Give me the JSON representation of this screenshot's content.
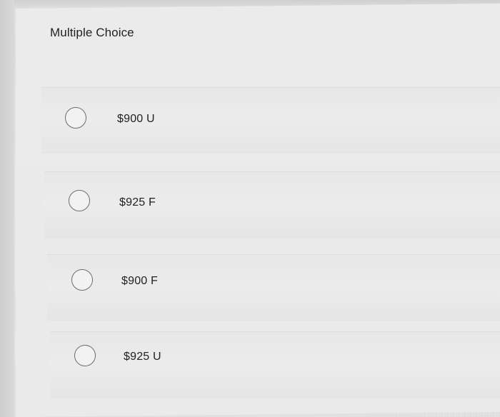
{
  "question": {
    "title": "Multiple Choice"
  },
  "options": [
    {
      "label": "$900 U",
      "selected": false
    },
    {
      "label": "$925 F",
      "selected": false
    },
    {
      "label": "$900 F",
      "selected": false
    },
    {
      "label": "$925 U",
      "selected": false
    }
  ]
}
